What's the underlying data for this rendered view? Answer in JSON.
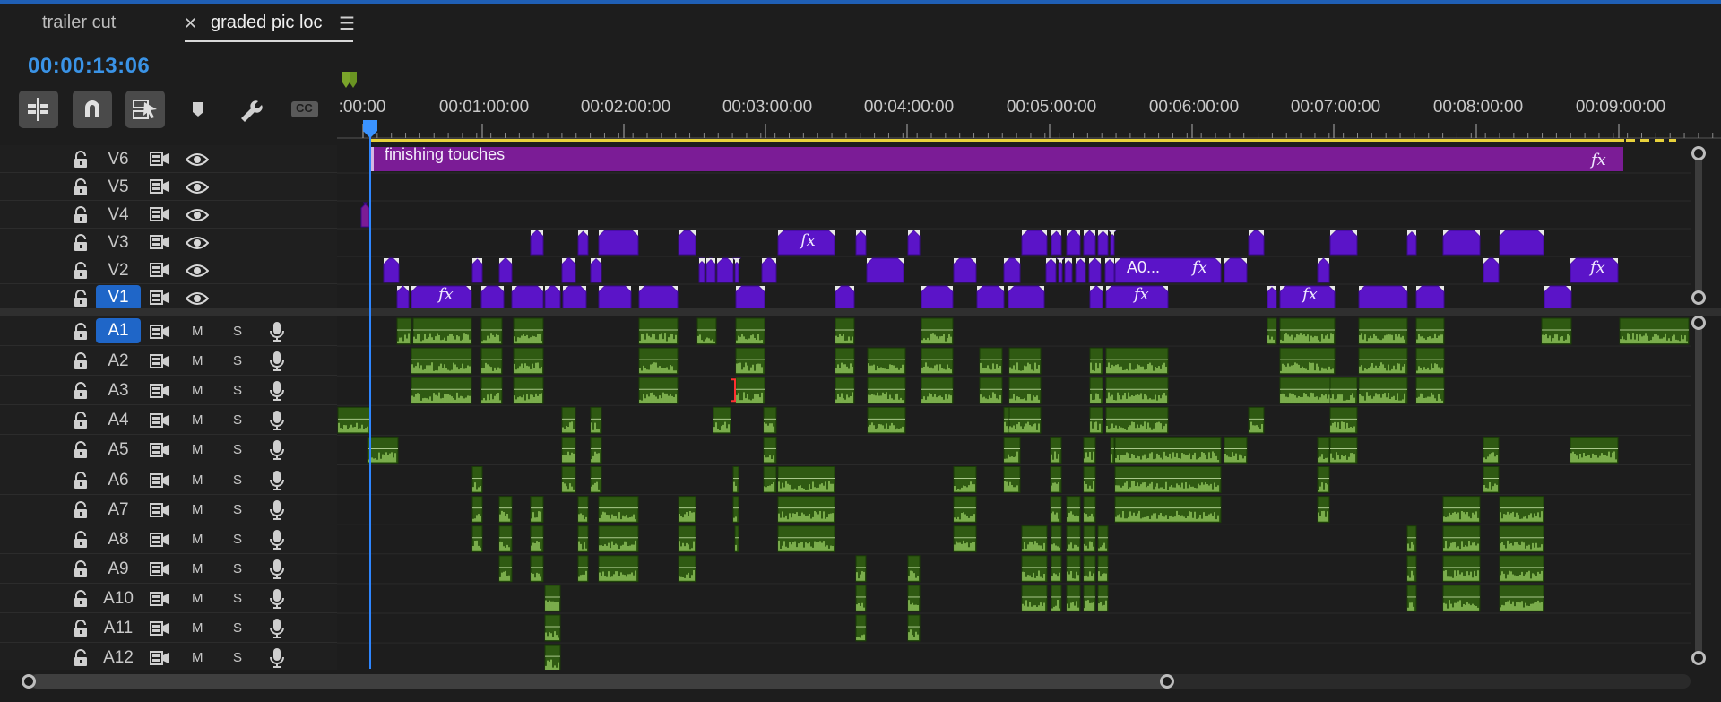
{
  "tabs": [
    {
      "label": "trailer cut",
      "active": false
    },
    {
      "label": "graded pic loc",
      "active": true
    }
  ],
  "timecode": "00:00:13:06",
  "toolbar": {
    "buttons": [
      {
        "name": "insert-overwrite-icon"
      },
      {
        "name": "snap-icon"
      },
      {
        "name": "linked-selection-icon"
      },
      {
        "name": "add-marker-icon"
      },
      {
        "name": "wrench-icon"
      },
      {
        "name": "captions-icon",
        "label": "CC"
      }
    ]
  },
  "ruler": {
    "labels": [
      ":00:00",
      "00:01:00:00",
      "00:02:00:00",
      "00:03:00:00",
      "00:04:00:00",
      "00:05:00:00",
      "00:06:00:00",
      "00:07:00:00",
      "00:08:00:00",
      "00:09:00:00"
    ]
  },
  "video_tracks": [
    {
      "name": "V6"
    },
    {
      "name": "V5"
    },
    {
      "name": "V4"
    },
    {
      "name": "V3"
    },
    {
      "name": "V2"
    },
    {
      "name": "V1",
      "highlighted": true
    }
  ],
  "audio_tracks": [
    {
      "name": "A1",
      "highlighted": true
    },
    {
      "name": "A2"
    },
    {
      "name": "A3"
    },
    {
      "name": "A4"
    },
    {
      "name": "A5"
    },
    {
      "name": "A6"
    },
    {
      "name": "A7"
    },
    {
      "name": "A8"
    },
    {
      "name": "A9"
    },
    {
      "name": "A10"
    },
    {
      "name": "A11"
    },
    {
      "name": "A12"
    }
  ],
  "mute_label": "M",
  "solo_label": "S",
  "clips": {
    "adjustment_layer": "finishing touches",
    "fx_label": "fx",
    "v2_named_clip": "A0..."
  },
  "colors": {
    "accent": "#3a93e6",
    "video_clip": "#5b14c8",
    "adjustment_clip": "#7b1c96",
    "audio_clip": "#2f5a12",
    "audio_wave": "#8ec25a",
    "playhead": "#2e86ff",
    "work_area": "#e8d23b"
  }
}
